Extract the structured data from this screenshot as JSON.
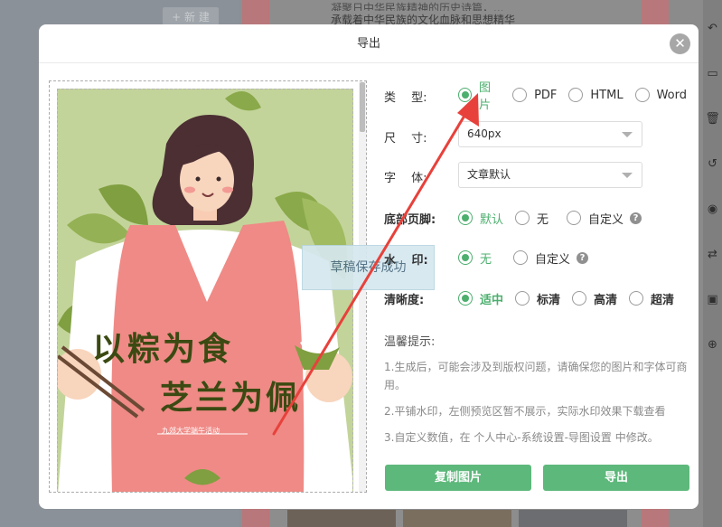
{
  "background": {
    "new_button_label": "+ 新 建",
    "editor_line1": "凝聚日中华民族精神的历史诗篇，...",
    "editor_line2": "承载着中华民族的文化血脉和思想精华",
    "toolbar_icons": [
      "undo-icon",
      "save-icon",
      "trash-icon",
      "history-icon",
      "eye-icon",
      "swap-icon",
      "image-icon",
      "zoom-icon"
    ]
  },
  "modal": {
    "title": "导出",
    "close_glyph": "✕"
  },
  "poster": {
    "title_line1": "以粽为食",
    "title_line2": "芝兰为佩",
    "subtitle": "九郊大学端午活动",
    "colors": {
      "background": "#c3d49a",
      "dress": "#ef8a86",
      "shirt": "#ffffff",
      "text": "#3b4a12"
    }
  },
  "toast": {
    "text": "草稿保存成功"
  },
  "form": {
    "type": {
      "label": "类　 型:",
      "options": [
        {
          "label": "图片",
          "checked": true
        },
        {
          "label": "PDF",
          "checked": false
        },
        {
          "label": "HTML",
          "checked": false
        },
        {
          "label": "Word",
          "checked": false
        }
      ]
    },
    "size": {
      "label": "尺　 寸:",
      "value": "640px"
    },
    "font": {
      "label": "字　 体:",
      "value": "文章默认"
    },
    "footer": {
      "label": "底部页脚:",
      "options": [
        {
          "label": "默认",
          "checked": true
        },
        {
          "label": "无",
          "checked": false
        },
        {
          "label": "自定义",
          "checked": false
        }
      ]
    },
    "watermark": {
      "label": "水　 印:",
      "options": [
        {
          "label": "无",
          "checked": true
        },
        {
          "label": "自定义",
          "checked": false
        }
      ]
    },
    "clarity": {
      "label": "清晰度:",
      "options": [
        {
          "label": "适中",
          "checked": true
        },
        {
          "label": "标清",
          "checked": false
        },
        {
          "label": "高清",
          "checked": false
        },
        {
          "label": "超清",
          "checked": false
        }
      ]
    },
    "help_glyph": "?"
  },
  "tips": {
    "title": "温馨提示:",
    "items": [
      "1.生成后，可能会涉及到版权问题，请确保您的图片和字体可商用。",
      "2.平铺水印，左侧预览区暂不展示，实际水印效果下载查看",
      "3.自定义数值，在 个人中心-系统设置-导图设置 中修改。"
    ]
  },
  "buttons": {
    "copy_image": "复制图片",
    "export": "导出"
  },
  "colors": {
    "accent": "#5db87b",
    "radio_checked": "#4caf6e",
    "arrow": "#e8413b"
  }
}
